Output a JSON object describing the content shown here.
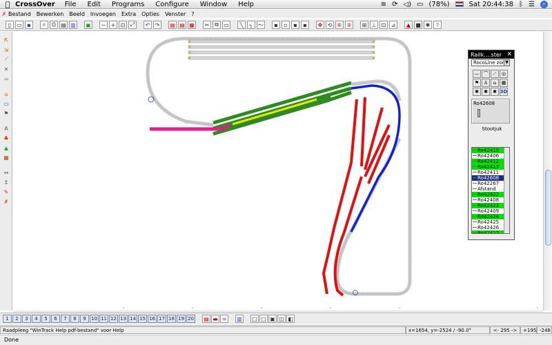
{
  "macbar": {
    "app_name": "CrossOver",
    "menus": [
      "File",
      "Edit",
      "Programs",
      "Configure",
      "Window",
      "Help"
    ],
    "battery": "(78%)",
    "clock": "Sat 20:44:38"
  },
  "appmenu": {
    "items": [
      "Bestand",
      "Bewerken",
      "Beeld",
      "Invoegen",
      "Extra",
      "Opties",
      "Venster",
      "?"
    ]
  },
  "palette": {
    "title": "Railk....ster",
    "close": "✕",
    "dropdown_value": "RocoLine zon",
    "selected_part": "Ro42608",
    "caption": "Stootjuk",
    "list": [
      {
        "label": "Ro42410",
        "state": "green"
      },
      {
        "label": "Ro42406",
        "state": "normal"
      },
      {
        "label": "Ro42412",
        "state": "green"
      },
      {
        "label": "Ro42413",
        "state": "green"
      },
      {
        "label": "Ro42411",
        "state": "normal"
      },
      {
        "label": "Ro42608",
        "state": "selected"
      },
      {
        "label": "Ro42267",
        "state": "normal"
      },
      {
        "label": "Afstand",
        "state": "normal"
      },
      {
        "label": "Ro42422",
        "state": "green"
      },
      {
        "label": "Ro42408",
        "state": "normal"
      },
      {
        "label": "Ro42423",
        "state": "green"
      },
      {
        "label": "Ro42409",
        "state": "normal"
      },
      {
        "label": "Ro42424",
        "state": "green"
      },
      {
        "label": "Ro42425",
        "state": "normal"
      },
      {
        "label": "Ro42426",
        "state": "normal"
      },
      {
        "label": "Ro42427",
        "state": "green"
      }
    ]
  },
  "pages": [
    "1",
    "2",
    "3",
    "4",
    "5",
    "6",
    "7",
    "8",
    "9",
    "10",
    "11",
    "12",
    "13",
    "14",
    "15",
    "16",
    "17",
    "18",
    "19",
    "20"
  ],
  "status": {
    "help": "Raadpleeg \"WinTrack Help pdf-bestand\" voor Help",
    "coords": "x=1654, y=-2524 / -90.0°",
    "count": "<- 295 ->",
    "extra1": "+1952",
    "extra2": "-248"
  },
  "done": "Done",
  "colors": {
    "track_gray": "#c8c8c8",
    "green": "#2e8b1f",
    "yellow": "#f0f000",
    "magenta": "#e0208a",
    "red": "#e01010",
    "blue": "#1020e0"
  }
}
